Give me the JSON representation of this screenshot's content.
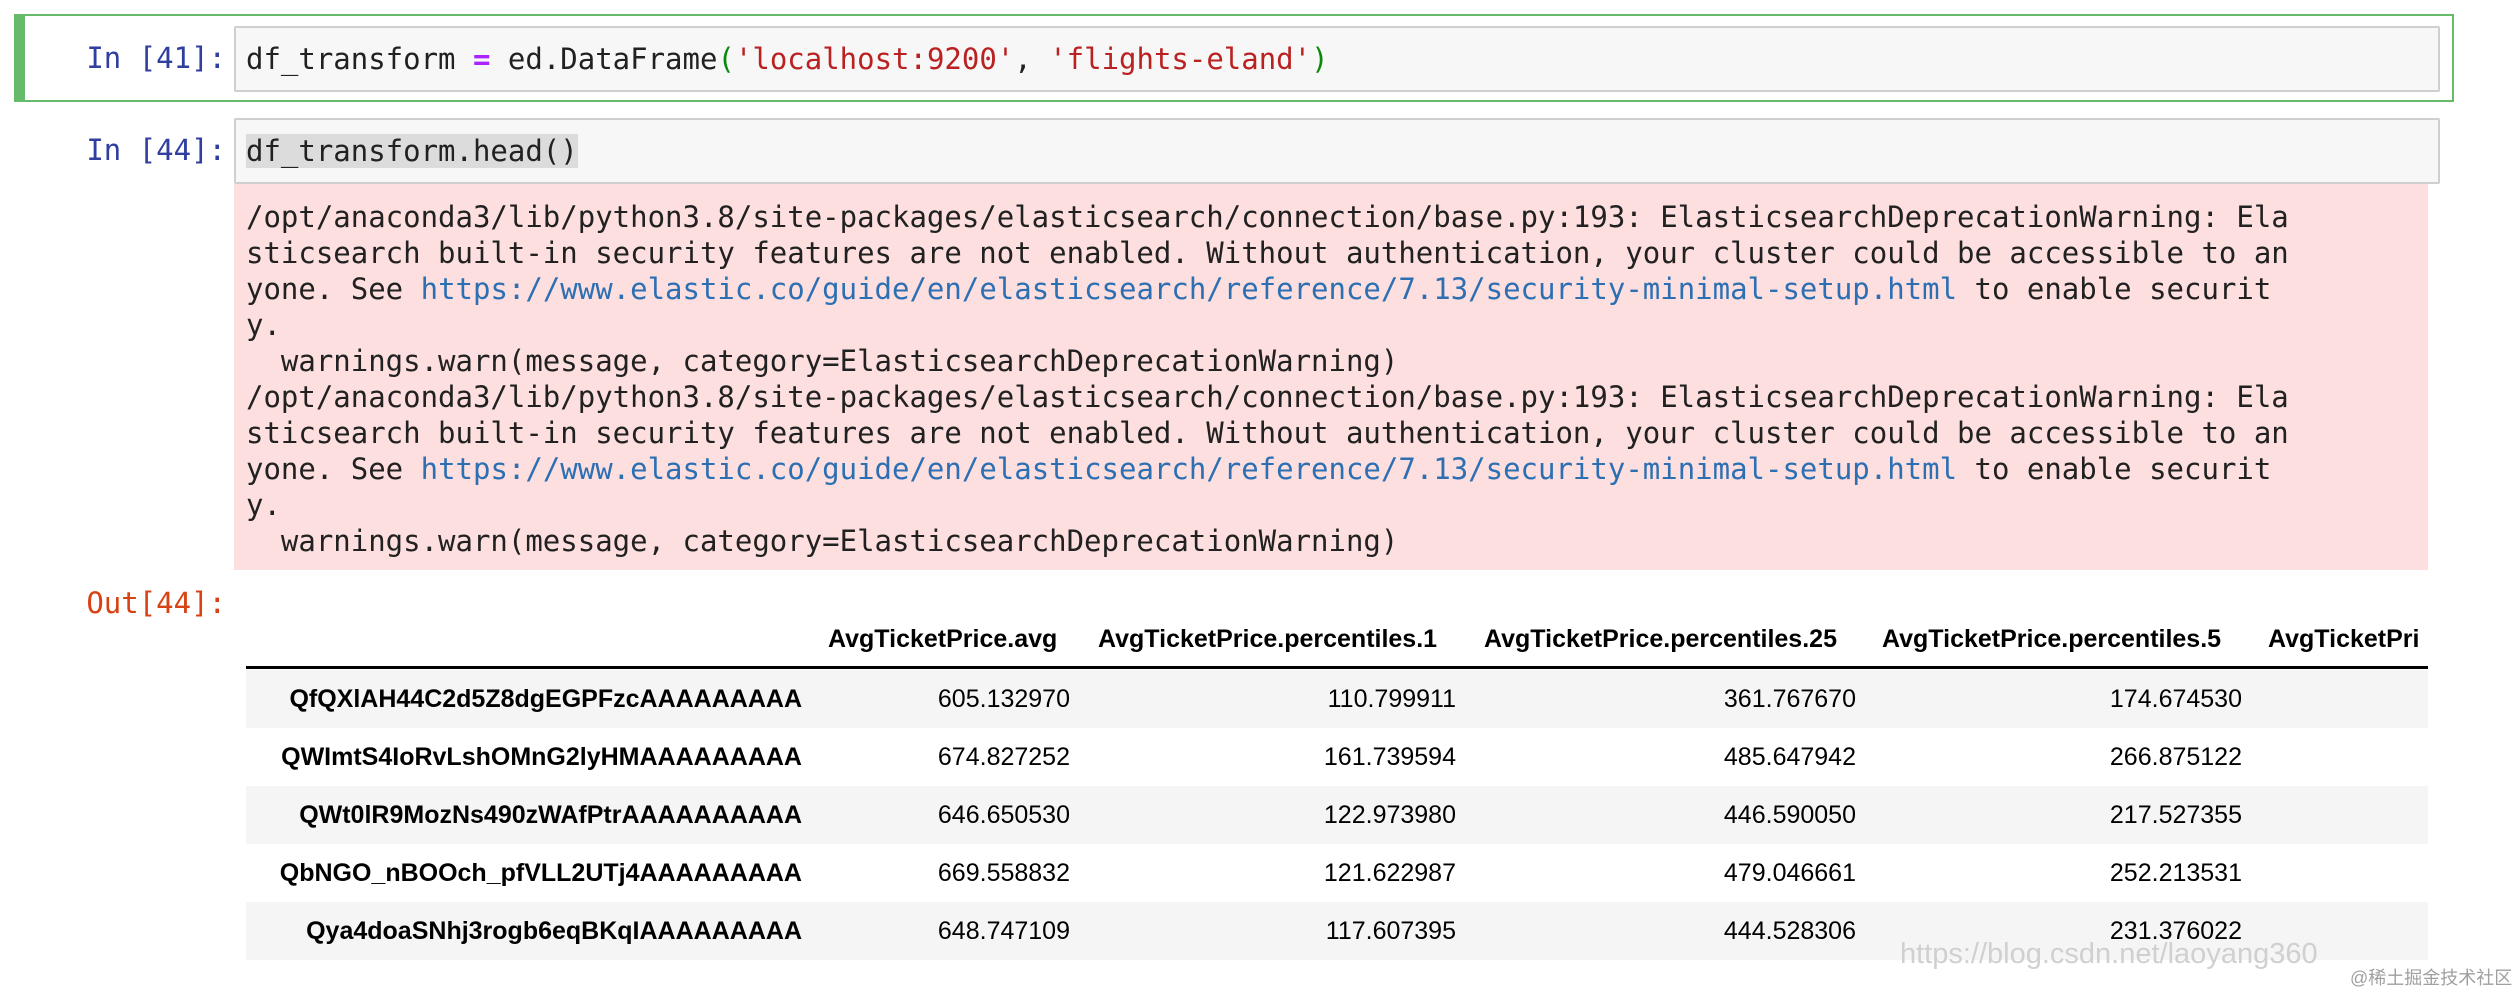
{
  "cell41": {
    "prompt": "In [41]:",
    "code": {
      "var": "df_transform ",
      "op": "=",
      "call": " ed.DataFrame",
      "open": "(",
      "arg1": "'localhost:9200'",
      "sep": ", ",
      "arg2": "'flights-eland'",
      "close": ")"
    }
  },
  "cell44": {
    "prompt": "In [44]:",
    "code": "df_transform.head()",
    "stderr": {
      "line1": "/opt/anaconda3/lib/python3.8/site-packages/elasticsearch/connection/base.py:193: ElasticsearchDeprecationWarning: Ela",
      "line2": "sticsearch built-in security features are not enabled. Without authentication, your cluster could be accessible to an",
      "line3_pre": "yone. See ",
      "line3_link": "https://www.elastic.co/guide/en/elasticsearch/reference/7.13/security-minimal-setup.html",
      "line3_post": " to enable securit",
      "line4": "y.",
      "line5": "  warnings.warn(message, category=ElasticsearchDeprecationWarning)",
      "line6": "/opt/anaconda3/lib/python3.8/site-packages/elasticsearch/connection/base.py:193: ElasticsearchDeprecationWarning: Ela",
      "line7": "sticsearch built-in security features are not enabled. Without authentication, your cluster could be accessible to an",
      "line8_pre": "yone. See ",
      "line8_link": "https://www.elastic.co/guide/en/elasticsearch/reference/7.13/security-minimal-setup.html",
      "line8_post": " to enable securit",
      "line9": "y.",
      "line10": "  warnings.warn(message, category=ElasticsearchDeprecationWarning)"
    },
    "out_prompt": "Out[44]:"
  },
  "dataframe": {
    "columns": [
      "AvgTicketPrice.avg",
      "AvgTicketPrice.percentiles.1",
      "AvgTicketPrice.percentiles.25",
      "AvgTicketPrice.percentiles.5",
      "AvgTicketPri"
    ],
    "rows": [
      {
        "index": "QfQXlAH44C2d5Z8dgEGPFzcAAAAAAAAA",
        "values": [
          "605.132970",
          "110.799911",
          "361.767670",
          "174.674530"
        ]
      },
      {
        "index": "QWImtS4IoRvLshOMnG2lyHMAAAAAAAAA",
        "values": [
          "674.827252",
          "161.739594",
          "485.647942",
          "266.875122"
        ]
      },
      {
        "index": "QWt0lR9MozNs490zWAfPtrAAAAAAAAAA",
        "values": [
          "646.650530",
          "122.973980",
          "446.590050",
          "217.527355"
        ]
      },
      {
        "index": "QbNGO_nBOOch_pfVLL2UTj4AAAAAAAAA",
        "values": [
          "669.558832",
          "121.622987",
          "479.046661",
          "252.213531"
        ]
      },
      {
        "index": "Qya4doaSNhj3rogb6eqBKqIAAAAAAAAA",
        "values": [
          "648.747109",
          "117.607395",
          "444.528306",
          "231.376022"
        ]
      }
    ]
  },
  "watermark": {
    "url": "https://blog.csdn.net/laoyang360",
    "tag": "@稀土掘金技术社区"
  }
}
